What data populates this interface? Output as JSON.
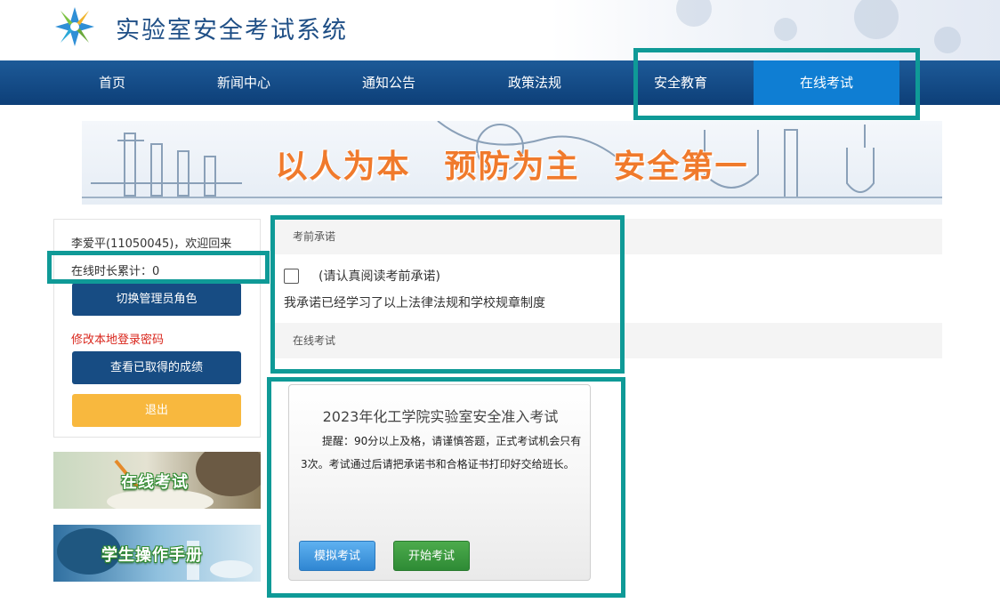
{
  "header": {
    "title": "实验室安全考试系统"
  },
  "nav": {
    "items": [
      "首页",
      "新闻中心",
      "通知公告",
      "政策法规",
      "安全教育",
      "在线考试"
    ],
    "active": "在线考试"
  },
  "banner": {
    "slogan": "以人为本　预防为主　安全第一"
  },
  "user": {
    "welcome": "李爱平(11050045)，欢迎回来",
    "online_time": "在线时长累计：0",
    "switch_role_label": "切换管理员角色",
    "change_password_label": "修改本地登录密码",
    "view_scores_label": "查看已取得的成绩",
    "logout_label": "退出"
  },
  "promos": {
    "online_exam": "在线考试",
    "manual": "学生操作手册"
  },
  "pledge": {
    "section_title": "考前承诺",
    "hint": "(请认真阅读考前承诺)",
    "text": "我承诺已经学习了以上法律法规和学校规章制度"
  },
  "exam": {
    "section_title": "在线考试",
    "title": "2023年化工学院实验室安全准入考试",
    "desc": "提醒：90分以上及格，请谨慎答题，正式考试机会只有3次。考试通过后请把承诺书和合格证书打印好交给班长。",
    "mock_label": "模拟考试",
    "start_label": "开始考试"
  },
  "colors": {
    "nav_bg": "#0d3f78",
    "nav_active": "#0f7ed3",
    "highlight": "#0f9a97",
    "primary_button": "#174c83",
    "logout_button": "#f8b83e",
    "link_red": "#d9261c",
    "slogan": "#f07a2c"
  }
}
